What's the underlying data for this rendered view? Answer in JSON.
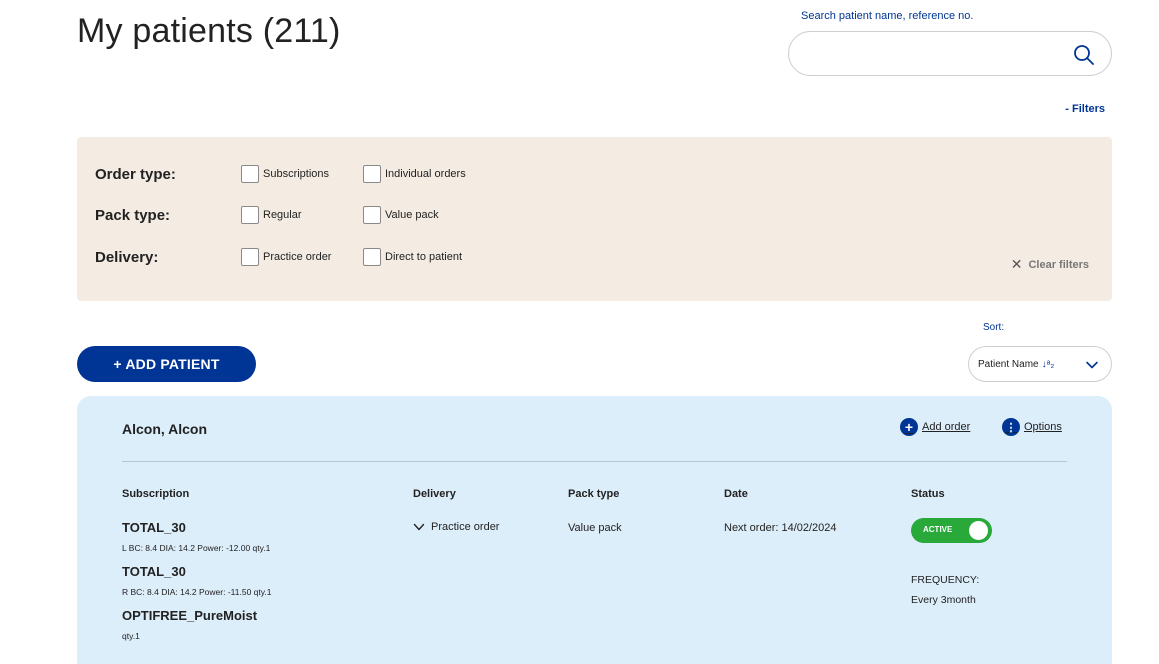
{
  "page": {
    "title": "My patients (211)"
  },
  "search": {
    "label": "Search patient name, reference no.",
    "value": "",
    "icon": "search-icon"
  },
  "filters": {
    "toggle_label": "- Filters",
    "rows": [
      {
        "label": "Order type:",
        "options": [
          "Subscriptions",
          "Individual orders"
        ]
      },
      {
        "label": "Pack type:",
        "options": [
          "Regular",
          "Value pack"
        ]
      },
      {
        "label": "Delivery:",
        "options": [
          "Practice order",
          "Direct to patient"
        ]
      }
    ],
    "clear_label": "Clear filters"
  },
  "actions": {
    "add_patient": "+ ADD PATIENT"
  },
  "sort": {
    "label": "Sort:",
    "selected": "Patient Name",
    "direction_icon": "↓a-z"
  },
  "patient": {
    "name": "Alcon, Alcon",
    "add_order": "Add order",
    "options": "Options",
    "columns": {
      "subscription": "Subscription",
      "delivery": "Delivery",
      "pack_type": "Pack type",
      "date": "Date",
      "status": "Status"
    },
    "products": [
      {
        "name": "TOTAL_30",
        "detail": "L BC: 8.4 DIA: 14.2 Power: -12.00 qty.1"
      },
      {
        "name": "TOTAL_30",
        "detail": "R BC: 8.4 DIA: 14.2 Power: -11.50 qty.1"
      },
      {
        "name": "OPTIFREE_PureMoist",
        "detail": "qty.1"
      }
    ],
    "delivery": "Practice order",
    "pack_type": "Value pack",
    "date": "Next order: 14/02/2024",
    "status": "ACTIVE",
    "status_color": "#28a93a",
    "frequency_label": "FREQUENCY:",
    "frequency_value": "Every 3month"
  },
  "colors": {
    "brand": "#003595",
    "filter_bg": "#f4ece3",
    "card_bg": "#ddeefb"
  }
}
